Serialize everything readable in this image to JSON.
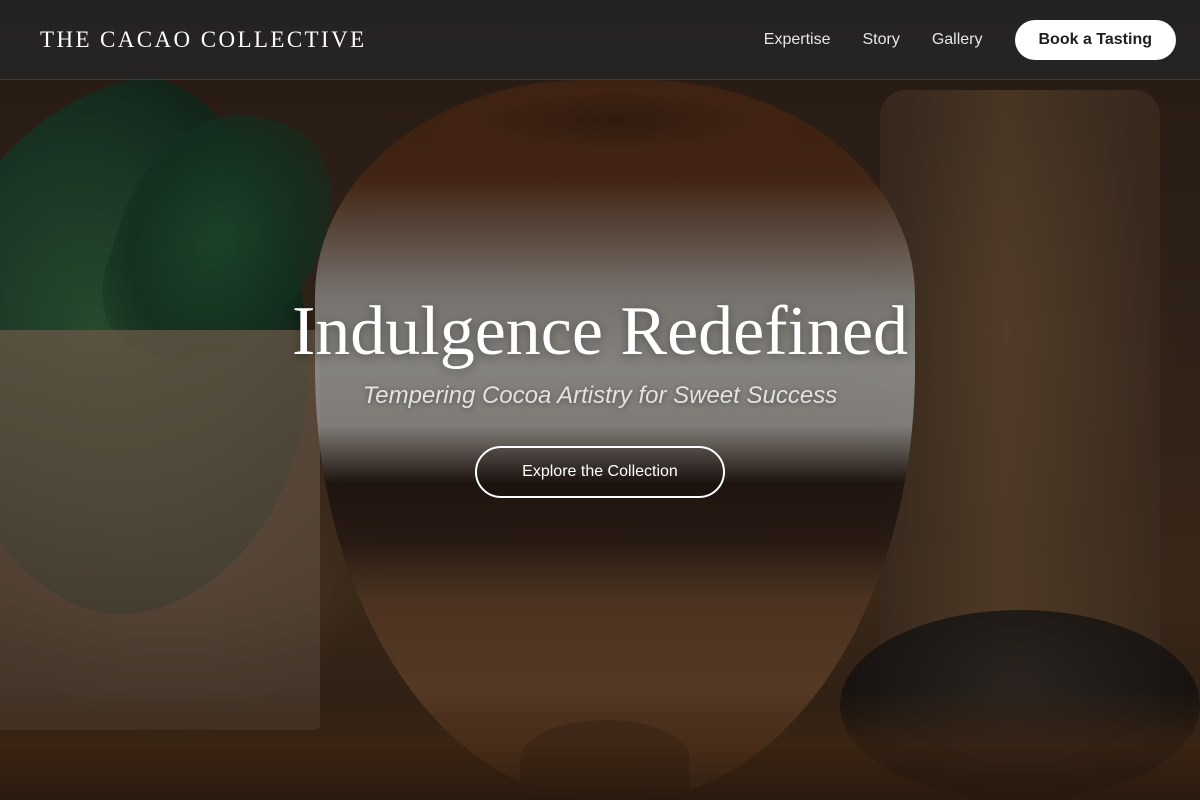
{
  "nav": {
    "brand": "THE CACAO COLLECTIVE",
    "links": [
      {
        "label": "Expertise"
      },
      {
        "label": "Story"
      },
      {
        "label": "Gallery"
      }
    ],
    "cta_label": "Book a Tasting"
  },
  "hero": {
    "title": "Indulgence Redefined",
    "subtitle": "Tempering Cocoa Artistry for Sweet Success",
    "cta_label": "Explore the Collection"
  },
  "colors": {
    "nav_background": "#262626",
    "text_primary": "#ffffff",
    "cta_background": "#ffffff",
    "cta_text": "#1f1f1f"
  }
}
